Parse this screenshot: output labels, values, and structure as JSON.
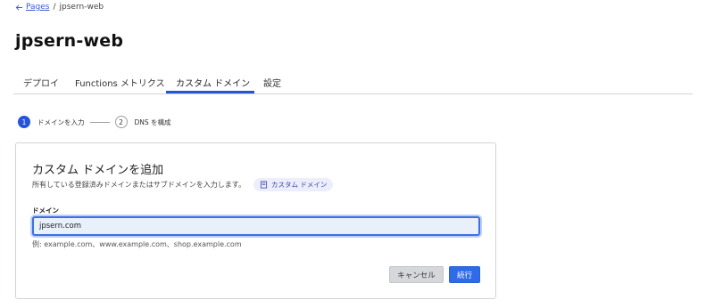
{
  "breadcrumb": {
    "back_label": "Pages",
    "separator": "/",
    "current": "jpsern-web"
  },
  "page": {
    "title": "jpsern-web"
  },
  "tabs": [
    {
      "label": "デプロイ",
      "active": false
    },
    {
      "label": "Functions メトリクス",
      "active": false
    },
    {
      "label": "カスタム ドメイン",
      "active": true
    },
    {
      "label": "設定",
      "active": false
    }
  ],
  "steps": [
    {
      "number": "1",
      "label": "ドメインを入力",
      "active": true
    },
    {
      "number": "2",
      "label": "DNS を構成",
      "active": false
    }
  ],
  "card": {
    "title": "カスタム ドメインを追加",
    "description": "所有している登録済みドメインまたはサブドメインを入力します。",
    "doc_link_label": "カスタム ドメイン",
    "field_label": "ドメイン",
    "input_value": "jpsern.com",
    "hint": "例: example.com、www.example.com、shop.example.com",
    "cancel_label": "キャンセル",
    "next_label": "続行"
  },
  "colors": {
    "accent": "#2554d8",
    "primary_button": "#2f6be8",
    "input_focus": "#3f6ee6"
  },
  "icons": {
    "back": "arrow-left-icon",
    "doc": "book-icon"
  }
}
